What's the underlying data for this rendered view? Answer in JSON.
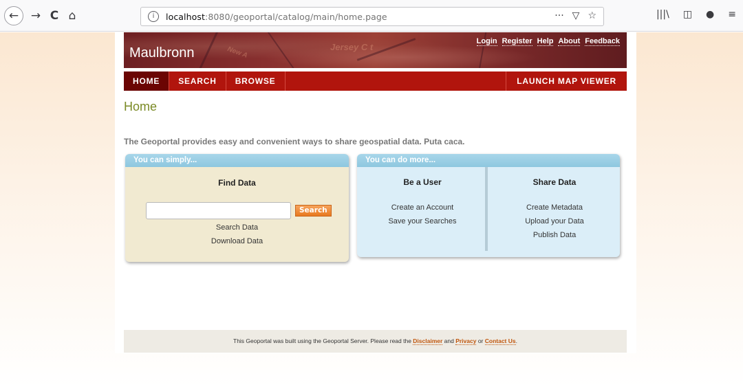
{
  "browser": {
    "url_host": "localhost",
    "url_rest": ":8080/geoportal/catalog/main/home.page",
    "info_icon": "i",
    "page_actions_icon": "···",
    "pocket_icon": "▽",
    "star_icon": "☆",
    "back_icon": "←",
    "forward_icon": "→",
    "reload_icon": "C",
    "home_icon": "⌂",
    "library_icon": "|||\\",
    "sidebar_icon": "◫",
    "account_icon": "●",
    "menu_icon": "≡"
  },
  "header": {
    "site_title": "Maulbronn",
    "links": [
      "Login",
      "Register",
      "Help",
      "About",
      "Feedback"
    ],
    "banner_map_text": [
      "Jersey C t",
      "New A"
    ]
  },
  "nav": {
    "tabs": [
      "HOME",
      "SEARCH",
      "BROWSE"
    ],
    "active": "HOME",
    "launch": "LAUNCH MAP VIEWER"
  },
  "main": {
    "title": "Home",
    "intro": "The Geoportal provides easy and convenient ways to share geospatial data. Puta caca."
  },
  "panel_left": {
    "header": "You can simply...",
    "title": "Find Data",
    "search_value": "",
    "search_button": "Search",
    "links": [
      "Search Data",
      "Download Data"
    ]
  },
  "panel_right": {
    "header": "You can do more...",
    "col_user": {
      "title": "Be a User",
      "links": [
        "Create an Account",
        "Save your Searches"
      ]
    },
    "col_share": {
      "title": "Share Data",
      "links": [
        "Create Metadata",
        "Upload your Data",
        "Publish Data"
      ]
    }
  },
  "footer": {
    "text_before": "This Geoportal was built using the Geoportal Server. Please read the ",
    "disclaimer": "Disclaimer",
    "and": " and ",
    "privacy": "Privacy",
    "or": " or ",
    "contact": "Contact Us",
    "end": "."
  }
}
